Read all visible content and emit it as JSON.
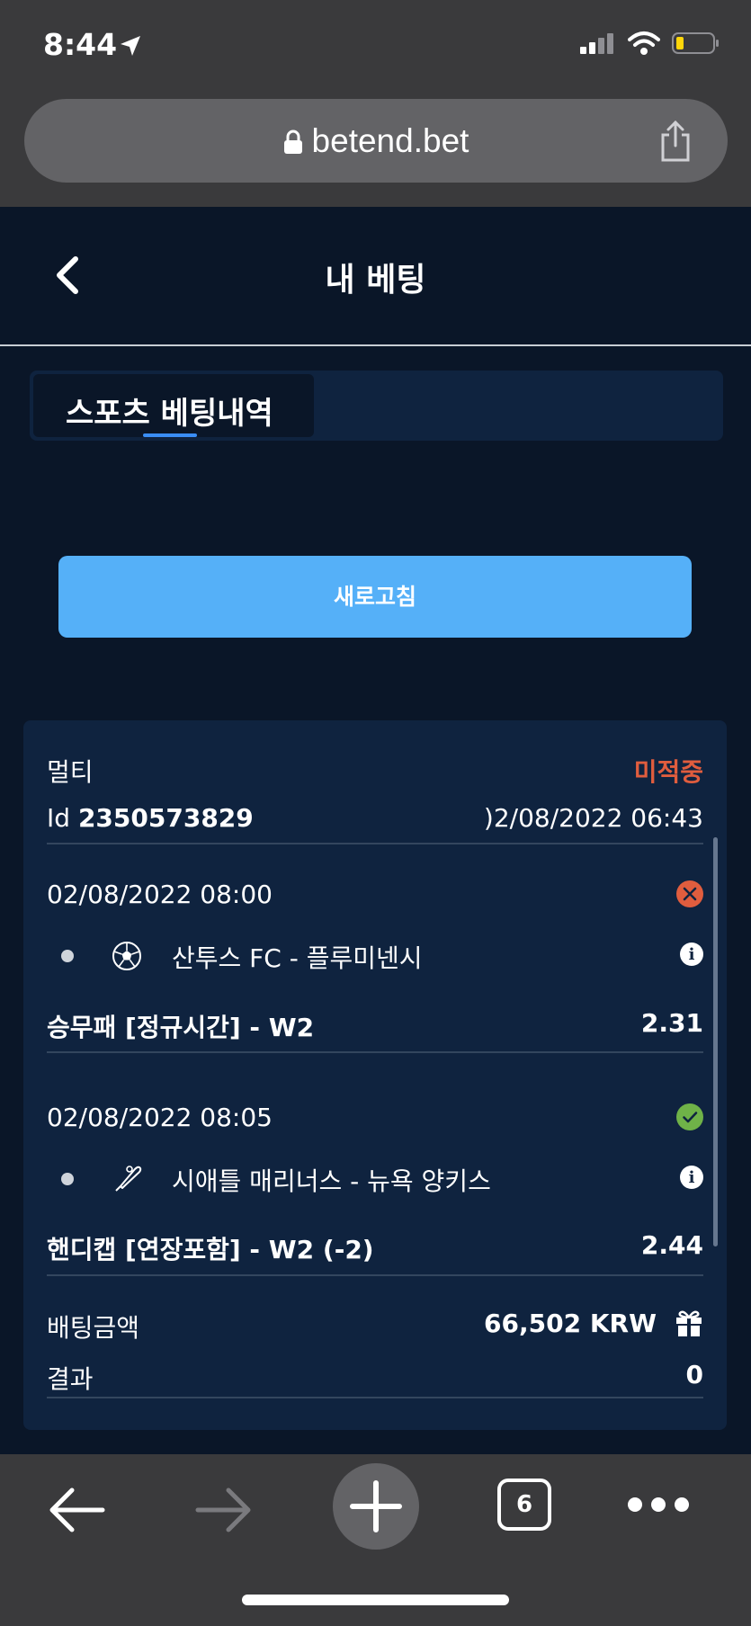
{
  "status_bar": {
    "time": "8:44"
  },
  "browser": {
    "url": "betend.bet",
    "tabs_count": "6"
  },
  "header": {
    "title": "내 베팅"
  },
  "tabs": [
    {
      "label": "스포츠 베팅내역",
      "active": true
    }
  ],
  "refresh_label": "새로고침",
  "bet": {
    "type": "멀티",
    "status": "미적중",
    "id_label": "Id",
    "id": "2350573829",
    "placed_at": ")2/08/2022 06:43",
    "selections": [
      {
        "datetime": "02/08/2022 08:00",
        "result": "lost",
        "sport_icon": "soccer-ball-icon",
        "match": "산투스 FC - 플루미넨시",
        "market": "승무패 [정규시간] - W2",
        "odds": "2.31"
      },
      {
        "datetime": "02/08/2022 08:05",
        "result": "won",
        "sport_icon": "baseball-bat-icon",
        "match": "시애틀 매리너스 - 뉴욕 양키스",
        "market": "핸디캡 [연장포함] - W2 (-2)",
        "odds": "2.44"
      }
    ],
    "stake_label": "배팅금액",
    "stake": "66,502 KRW",
    "result_label": "결과",
    "result_value": "0"
  },
  "colors": {
    "background": "#0a1628",
    "card": "#0f233f",
    "accent": "#55b0f8",
    "lost": "#e05d3e",
    "won": "#6fb248"
  }
}
